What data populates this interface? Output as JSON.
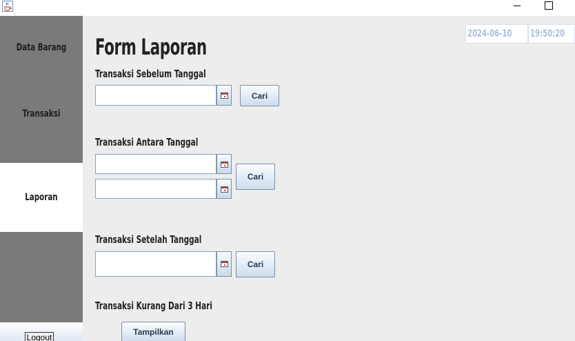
{
  "icons": {
    "app": "java-cup-icon",
    "minimize": "minimize-icon",
    "maximize": "maximize-icon",
    "calendar": "calendar-icon"
  },
  "sidebar": {
    "items": [
      {
        "label": "Data Barang",
        "active": false
      },
      {
        "label": "Transaksi",
        "active": false
      },
      {
        "label": "Laporan",
        "active": true
      }
    ],
    "logout_label": "Logout"
  },
  "header": {
    "date": "2024-06-10",
    "time": "19:50:20"
  },
  "form": {
    "title": "Form Laporan",
    "before": {
      "label": "Transaksi Sebelum Tanggal",
      "date_value": "",
      "search_label": "Cari"
    },
    "between": {
      "label": "Transaksi Antara Tanggal",
      "start_value": "",
      "end_value": "",
      "search_label": "Cari"
    },
    "after": {
      "label": "Transaksi Setelah Tanggal",
      "date_value": "",
      "search_label": "Cari"
    },
    "recent": {
      "label": "Transaksi Kurang Dari 3 Hari",
      "show_label": "Tampilkan"
    }
  },
  "colors": {
    "sidebar_bg": "#7a7a7a",
    "active_item_bg": "#ffffff",
    "main_bg": "#ededed",
    "clock_text": "#a9c0dd"
  }
}
